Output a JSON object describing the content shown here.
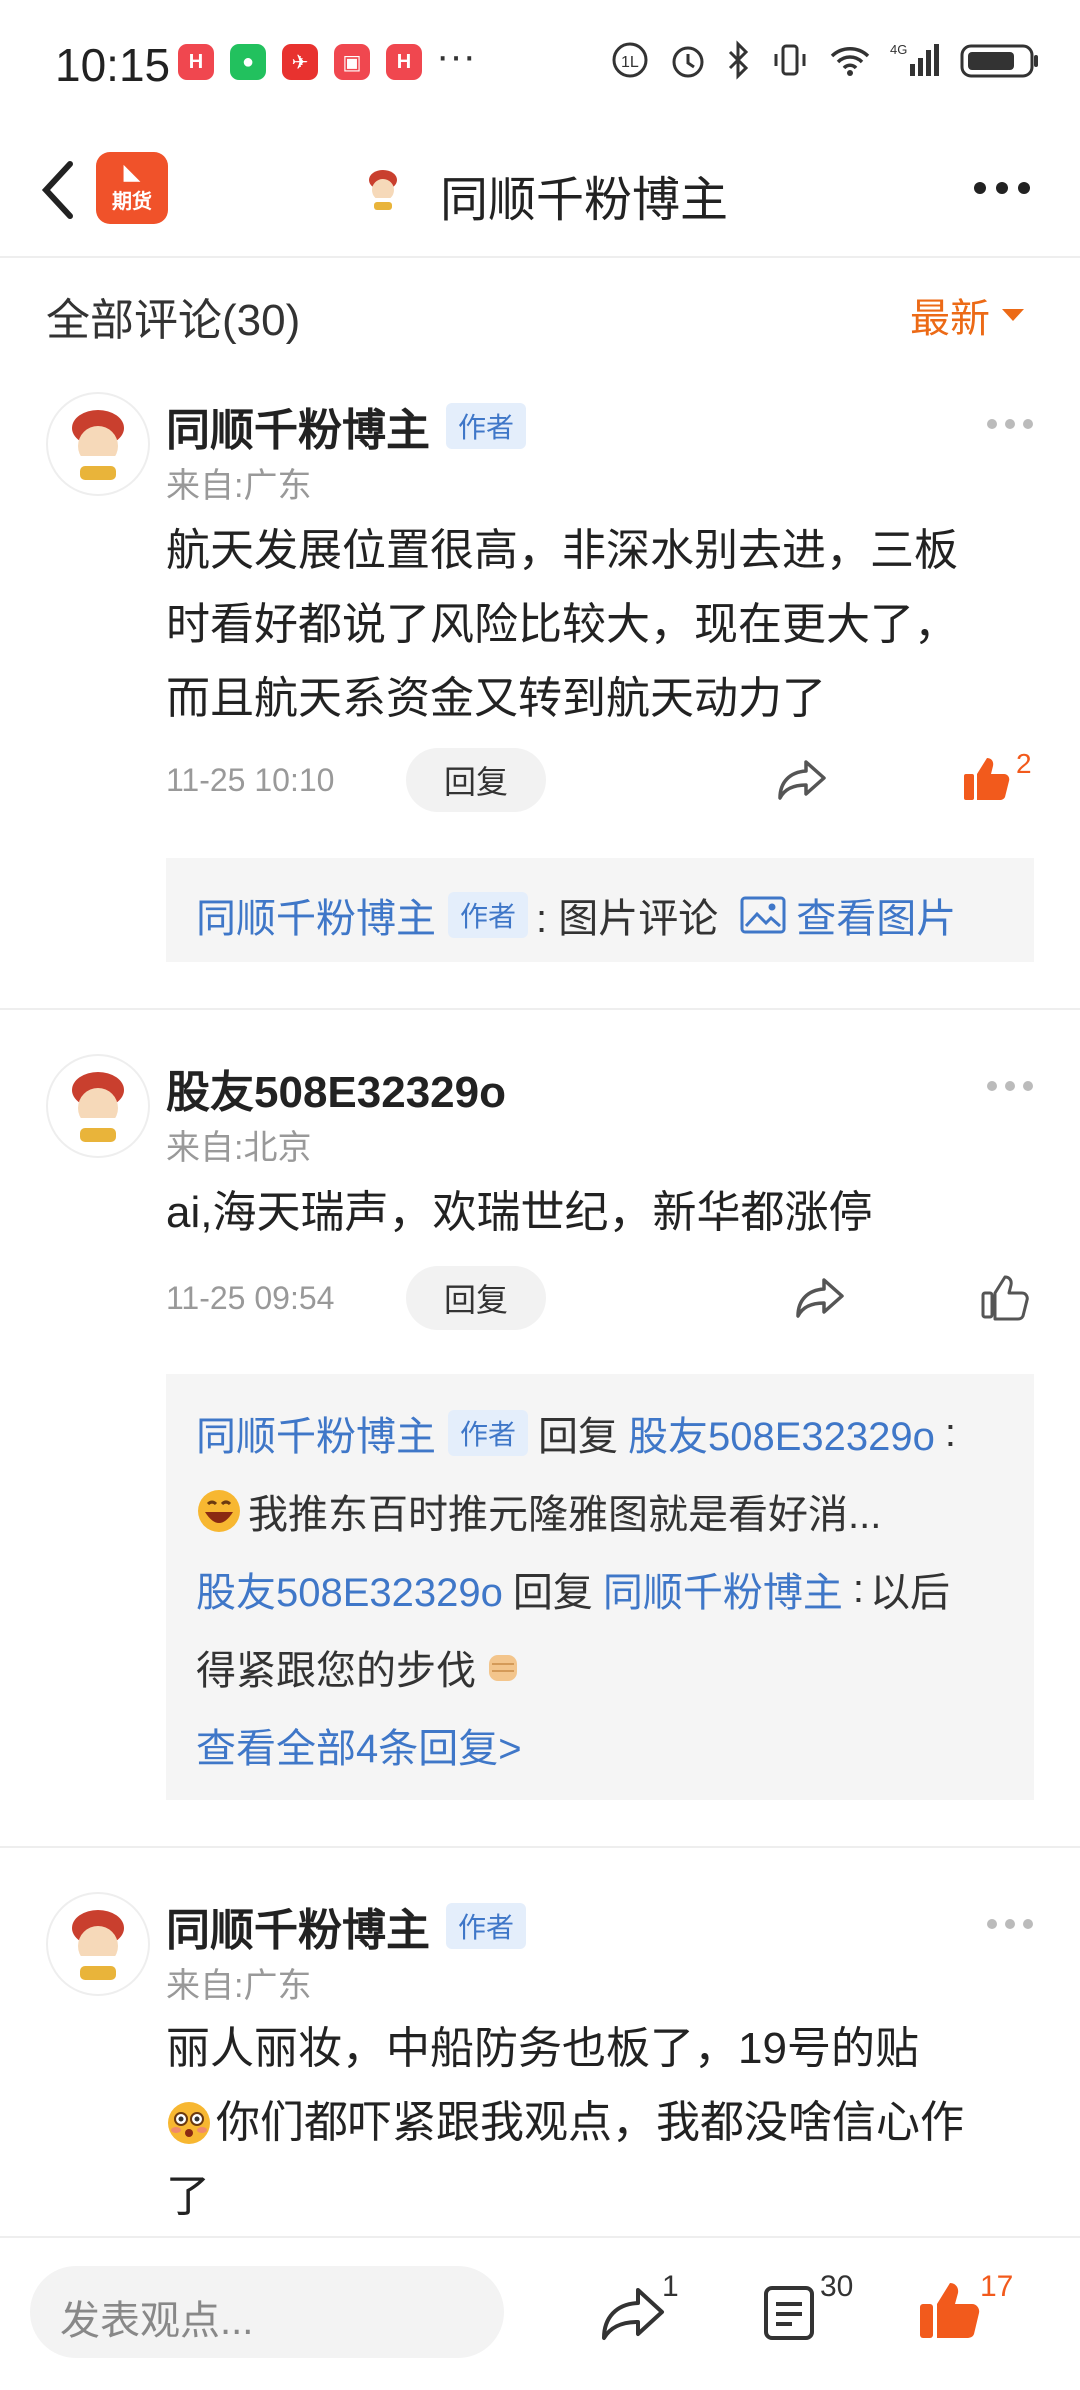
{
  "status_bar": {
    "time": "10:15",
    "more": "···"
  },
  "header": {
    "title": "同顺千粉博主",
    "logo_label": "期货"
  },
  "comments_header": {
    "title": "全部评论(30)",
    "sort_label": "最新"
  },
  "comments": [
    {
      "name": "同顺千粉博主",
      "badge": "作者",
      "location": "来自:广东",
      "text_lines": [
        "航天发展位置很高，非深水别去进，三板",
        "时看好都说了风险比较大，现在更大了，",
        "而且航天系资金又转到航天动力了"
      ],
      "time": "11-25 10:10",
      "reply_label": "回复",
      "like_count": "2",
      "sub": {
        "name": "同顺千粉博主",
        "badge": "作者",
        "text": ":  图片评论",
        "link": "查看图片"
      }
    },
    {
      "name": "股友508E32329o",
      "location": "来自:北京",
      "text": "ai,海天瑞声，欢瑞世纪，新华都涨停",
      "time": "11-25 09:54",
      "reply_label": "回复",
      "replies": [
        {
          "from": "同顺千粉博主",
          "badge": "作者",
          "verb": "回复",
          "to": "股友508E32329o",
          "colon": ":",
          "text": "我推东百时推元隆雅图就是看好消..."
        },
        {
          "from": "股友508E32329o",
          "verb": "回复",
          "to": "同顺千粉博主",
          "colon": ":",
          "text1": "以后",
          "text2": "得紧跟您的步伐"
        }
      ],
      "view_all": "查看全部4条回复>"
    },
    {
      "name": "同顺千粉博主",
      "badge": "作者",
      "location": "来自:广东",
      "text_line1": "丽人丽妆，中船防务也板了，19号的贴",
      "text_line2": "你们都吓紧跟我观点，我都没啥信心作",
      "text_line3": "了"
    }
  ],
  "bottom_bar": {
    "placeholder": "发表观点...",
    "share_count": "1",
    "comment_count": "30",
    "like_count": "17"
  },
  "colors": {
    "accent": "#ec6a16",
    "link_blue": "#3f77c8",
    "like_orange": "#f25a1c"
  }
}
